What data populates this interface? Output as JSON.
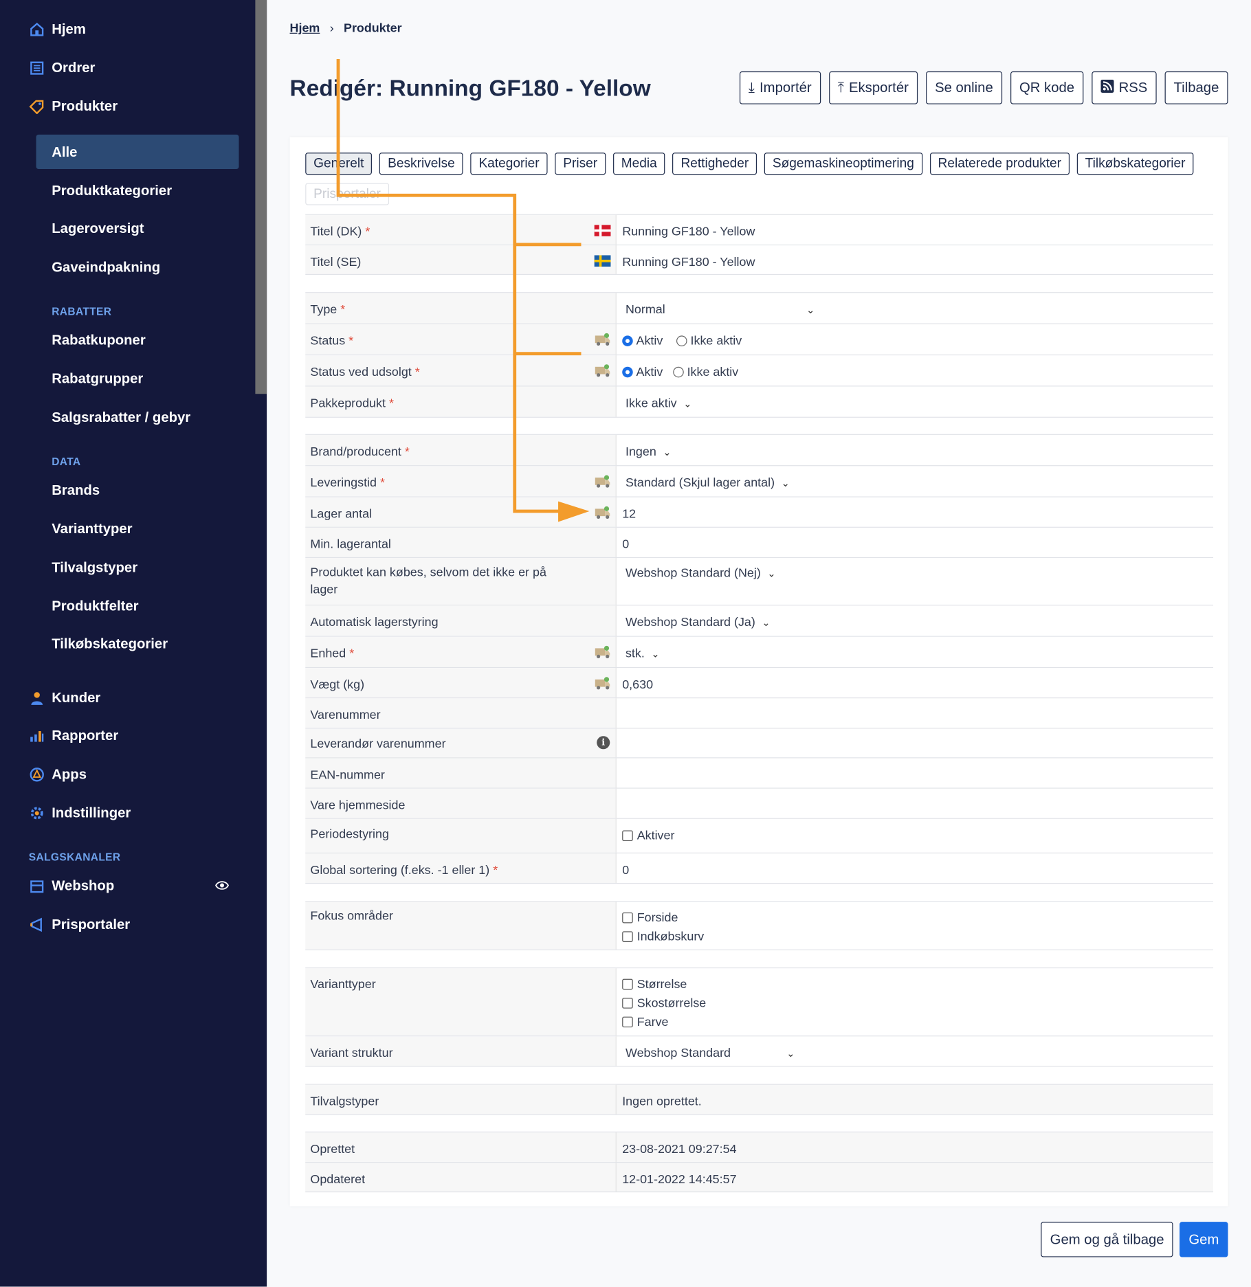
{
  "sidebar": {
    "items": [
      {
        "label": "Hjem",
        "icon": "home-icon"
      },
      {
        "label": "Ordrer",
        "icon": "orders-icon"
      },
      {
        "label": "Produkter",
        "icon": "tag-icon"
      }
    ],
    "products_sub": [
      "Alle",
      "Produktkategorier",
      "Lageroversigt",
      "Gaveindpakning"
    ],
    "rabatter_heading": "RABATTER",
    "rabatter": [
      "Rabatkuponer",
      "Rabatgrupper",
      "Salgsrabatter / gebyr"
    ],
    "data_heading": "DATA",
    "data": [
      "Brands",
      "Varianttyper",
      "Tilvalgstyper",
      "Produktfelter",
      "Tilkøbskategorier"
    ],
    "lower": [
      {
        "label": "Kunder",
        "icon": "customer-icon"
      },
      {
        "label": "Rapporter",
        "icon": "chart-icon"
      },
      {
        "label": "Apps",
        "icon": "apps-icon"
      },
      {
        "label": "Indstillinger",
        "icon": "gear-icon"
      }
    ],
    "channels_heading": "SALGSKANALER",
    "channels": [
      {
        "label": "Webshop",
        "icon": "webshop-icon"
      },
      {
        "label": "Prisportaler",
        "icon": "megaphone-icon"
      }
    ]
  },
  "breadcrumb": {
    "home": "Hjem",
    "current": "Produkter"
  },
  "page_title": "Redigér: Running GF180 - Yellow",
  "top_buttons": {
    "import": "Importér",
    "export": "Eksportér",
    "online": "Se online",
    "qr": "QR kode",
    "rss": "RSS",
    "back": "Tilbage"
  },
  "tabs": [
    "Generelt",
    "Beskrivelse",
    "Kategorier",
    "Priser",
    "Media",
    "Rettigheder",
    "Søgemaskineoptimering",
    "Relaterede produkter",
    "Tilkøbskategorier",
    "Prisportaler"
  ],
  "form": {
    "title_dk": {
      "label": "Titel (DK)",
      "value": "Running GF180 - Yellow"
    },
    "title_se": {
      "label": "Titel (SE)",
      "value": "Running GF180 - Yellow"
    },
    "type": {
      "label": "Type",
      "value": "Normal"
    },
    "status": {
      "label": "Status",
      "opt1": "Aktiv",
      "opt2": "Ikke aktiv"
    },
    "status_soldout": {
      "label": "Status ved udsolgt",
      "opt1": "Aktiv",
      "opt2": "Ikke aktiv"
    },
    "package": {
      "label": "Pakkeprodukt",
      "value": "Ikke aktiv"
    },
    "brand": {
      "label": "Brand/producent",
      "value": "Ingen"
    },
    "delivery": {
      "label": "Leveringstid",
      "value": "Standard (Skjul lager antal)"
    },
    "stock": {
      "label": "Lager antal",
      "value": "12"
    },
    "min_stock": {
      "label": "Min. lagerantal",
      "value": "0"
    },
    "backorder": {
      "label": "Produktet kan købes, selvom det ikke er på lager",
      "value": "Webshop Standard (Nej)"
    },
    "auto_stock": {
      "label": "Automatisk lagerstyring",
      "value": "Webshop Standard (Ja)"
    },
    "unit": {
      "label": "Enhed",
      "value": "stk."
    },
    "weight": {
      "label": "Vægt (kg)",
      "value": "0,630"
    },
    "sku": {
      "label": "Varenummer"
    },
    "supplier_sku": {
      "label": "Leverandør varenummer"
    },
    "ean": {
      "label": "EAN-nummer"
    },
    "homepage": {
      "label": "Vare hjemmeside"
    },
    "period": {
      "label": "Periodestyring",
      "value": "Aktiver"
    },
    "sort": {
      "label": "Global sortering (f.eks. -1 eller 1)",
      "value": "0"
    },
    "focus": {
      "label": "Fokus områder",
      "opt1": "Forside",
      "opt2": "Indkøbskurv"
    },
    "variant_types": {
      "label": "Varianttyper",
      "opt1": "Størrelse",
      "opt2": "Skostørrelse",
      "opt3": "Farve"
    },
    "variant_structure": {
      "label": "Variant struktur",
      "value": "Webshop Standard"
    },
    "addon_types": {
      "label": "Tilvalgstyper",
      "value": "Ingen oprettet."
    },
    "created": {
      "label": "Oprettet",
      "value": "23-08-2021 09:27:54"
    },
    "updated": {
      "label": "Opdateret",
      "value": "12-01-2022 14:45:57"
    }
  },
  "bottom_buttons": {
    "save_back": "Gem og gå tilbage",
    "save": "Gem"
  },
  "colors": {
    "sidebar": "#14183b",
    "active": "#2c4a74",
    "accent": "#1a6ee6",
    "annotation": "#f39c2c",
    "required": "#e04b3a"
  }
}
